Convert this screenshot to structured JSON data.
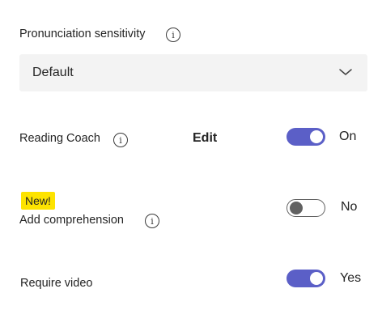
{
  "pronunciation": {
    "label": "Pronunciation sensitivity",
    "dropdown_value": "Default"
  },
  "reading_coach": {
    "label": "Reading Coach",
    "edit_label": "Edit",
    "toggle_on": true,
    "state_text": "On"
  },
  "comprehension": {
    "badge": "New!",
    "label": "Add comprehension",
    "toggle_on": false,
    "state_text": "No"
  },
  "video": {
    "label": "Require video",
    "toggle_on": true,
    "state_text": "Yes"
  },
  "colors": {
    "accent": "#5b5fc7",
    "badge": "#fde300",
    "dropdown_bg": "#f3f3f3",
    "toggle_off": "#616161"
  },
  "icons": {
    "info": "info-icon",
    "chevron": "chevron-down-icon"
  }
}
